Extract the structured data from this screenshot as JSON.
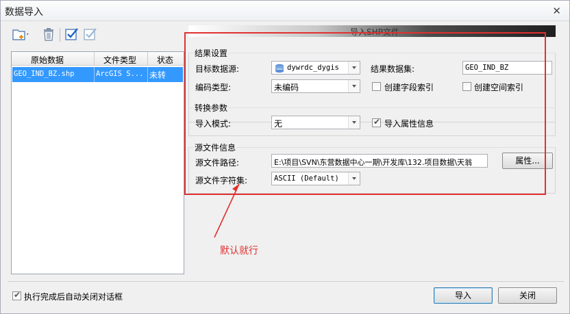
{
  "window": {
    "title": "数据导入",
    "close_glyph": "✕"
  },
  "toolbar": {
    "add_icon": "add-file-icon",
    "delete_icon": "trash-icon",
    "check_all_icon": "check-all-icon",
    "uncheck_icon": "uncheck-icon"
  },
  "file_list": {
    "columns": [
      "原始数据",
      "文件类型",
      "状态"
    ],
    "rows": [
      {
        "name": "GEO_IND_BZ.shp",
        "type": "ArcGIS S...",
        "status": "未转"
      }
    ]
  },
  "banner": {
    "title": "导入SHP文件"
  },
  "result_settings": {
    "title": "结果设置",
    "target_datasource_label": "目标数据源:",
    "target_datasource_value": "dywrdc_dygis",
    "result_dataset_label": "结果数据集:",
    "result_dataset_value": "GEO_IND_BZ",
    "encoding_label": "编码类型:",
    "encoding_value": "未编码",
    "field_index_label": "创建字段索引",
    "field_index_checked": false,
    "spatial_index_label": "创建空间索引",
    "spatial_index_checked": false
  },
  "conversion": {
    "title": "转换参数",
    "import_mode_label": "导入模式:",
    "import_mode_value": "无",
    "import_attr_label": "导入属性信息",
    "import_attr_checked": true
  },
  "source": {
    "title": "源文件信息",
    "path_label": "源文件路径:",
    "path_value": "E:\\项目\\SVN\\东营数据中心一期\\开发库\\132.项目数据\\天翁",
    "props_button": "属性...",
    "charset_label": "源文件字符集:",
    "charset_value": "ASCII (Default)"
  },
  "annotation": {
    "text": "默认就行",
    "color": "#e03030"
  },
  "footer": {
    "auto_close_label": "执行完成后自动关闭对话框",
    "auto_close_checked": true,
    "import_button": "导入",
    "close_button": "关闭"
  },
  "colors": {
    "selection": "#3399ff",
    "annotation_red": "#e03030"
  }
}
